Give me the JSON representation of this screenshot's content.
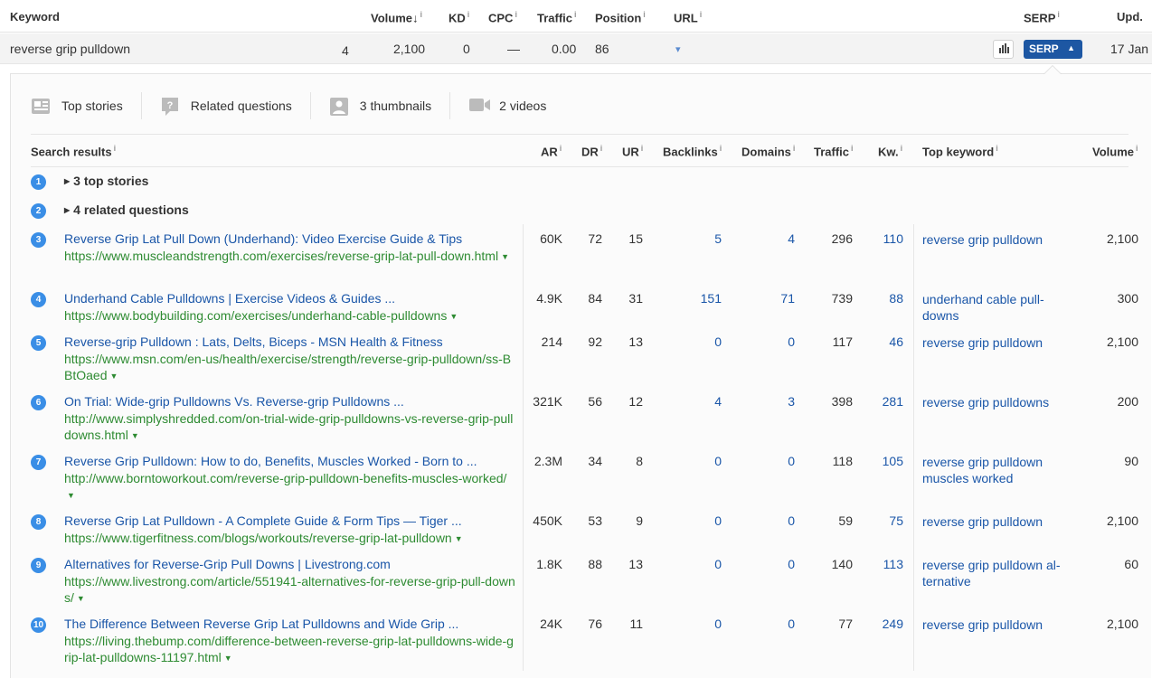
{
  "keyword_table": {
    "headers": {
      "keyword": "Keyword",
      "volume": "Volume",
      "volume_sort": "↓",
      "kd": "KD",
      "cpc": "CPC",
      "traffic": "Traffic",
      "position": "Position",
      "url": "URL",
      "serp": "SERP",
      "upd": "Upd."
    },
    "row": {
      "keyword": "reverse grip pulldown",
      "small_count": "4",
      "volume": "2,100",
      "kd": "0",
      "cpc": "—",
      "traffic": "0.00",
      "position": "86",
      "url_dropdown": "▾",
      "serp_button": "SERP",
      "serp_arrow": "▲",
      "updated": "17 Jan"
    }
  },
  "serp_features": [
    {
      "label": "Top stories",
      "icon": "newspaper-icon"
    },
    {
      "label": "Related questions",
      "icon": "question-bubble-icon"
    },
    {
      "label": "3 thumbnails",
      "icon": "image-icon"
    },
    {
      "label": "2 videos",
      "icon": "video-camera-icon"
    }
  ],
  "results_headers": {
    "search_results": "Search results",
    "ar": "AR",
    "dr": "DR",
    "ur": "UR",
    "backlinks": "Backlinks",
    "domains": "Domains",
    "traffic": "Traffic",
    "kw": "Kw.",
    "top_keyword": "Top keyword",
    "volume": "Volume",
    "info": "i"
  },
  "groups": [
    {
      "num": "1",
      "label": "3 top stories"
    },
    {
      "num": "2",
      "label": "4 related questions"
    }
  ],
  "results": [
    {
      "num": "3",
      "title": "Reverse Grip Lat Pull Down (Underhand): Video Exercise Guide & Tips",
      "url": "https://www.muscleandstrength.com/exercises/reverse-grip-lat-pull-down.html",
      "ar": "60K",
      "dr": "72",
      "ur": "15",
      "backlinks": "5",
      "domains": "4",
      "traffic": "296",
      "kw": "110",
      "top_keyword": "reverse grip pulldown",
      "volume": "2,100"
    },
    {
      "num": "4",
      "title": "Underhand Cable Pulldowns | Exercise Videos & Guides ...",
      "url": "https://www.bodybuilding.com/exercises/underhand-cable-pulldowns",
      "ar": "4.9K",
      "dr": "84",
      "ur": "31",
      "backlinks": "151",
      "domains": "71",
      "traffic": "739",
      "kw": "88",
      "top_keyword": "underhand cable pull-downs",
      "volume": "300"
    },
    {
      "num": "5",
      "title": "Reverse-grip Pulldown : Lats, Delts, Biceps - MSN Health & Fitness",
      "url": "https://www.msn.com/en-us/health/exercise/strength/reverse-grip-pulldown/ss-BBtOaed",
      "ar": "214",
      "dr": "92",
      "ur": "13",
      "backlinks": "0",
      "domains": "0",
      "traffic": "117",
      "kw": "46",
      "top_keyword": "reverse grip pulldown",
      "volume": "2,100"
    },
    {
      "num": "6",
      "title": "On Trial: Wide-grip Pulldowns Vs. Reverse-grip Pulldowns ...",
      "url": "http://www.simplyshredded.com/on-trial-wide-grip-pulldowns-vs-reverse-grip-pulldowns.html",
      "ar": "321K",
      "dr": "56",
      "ur": "12",
      "backlinks": "4",
      "domains": "3",
      "traffic": "398",
      "kw": "281",
      "top_keyword": "reverse grip pulldowns",
      "volume": "200"
    },
    {
      "num": "7",
      "title": "Reverse Grip Pulldown: How to do, Benefits, Muscles Worked - Born to ...",
      "url": "http://www.borntoworkout.com/reverse-grip-pulldown-benefits-muscles-worked/",
      "ar": "2.3M",
      "dr": "34",
      "ur": "8",
      "backlinks": "0",
      "domains": "0",
      "traffic": "118",
      "kw": "105",
      "top_keyword": "reverse grip pulldown muscles worked",
      "volume": "90"
    },
    {
      "num": "8",
      "title": "Reverse Grip Lat Pulldown - A Complete Guide & Form Tips — Tiger ...",
      "url": "https://www.tigerfitness.com/blogs/workouts/reverse-grip-lat-pulldown",
      "ar": "450K",
      "dr": "53",
      "ur": "9",
      "backlinks": "0",
      "domains": "0",
      "traffic": "59",
      "kw": "75",
      "top_keyword": "reverse grip pulldown",
      "volume": "2,100"
    },
    {
      "num": "9",
      "title": "Alternatives for Reverse-Grip Pull Downs | Livestrong.com",
      "url": "https://www.livestrong.com/article/551941-alternatives-for-reverse-grip-pull-downs/",
      "ar": "1.8K",
      "dr": "88",
      "ur": "13",
      "backlinks": "0",
      "domains": "0",
      "traffic": "140",
      "kw": "113",
      "top_keyword": "reverse grip pulldown al-ternative",
      "volume": "60"
    },
    {
      "num": "10",
      "title": "The Difference Between Reverse Grip Lat Pulldowns and Wide Grip ...",
      "url": "https://living.thebump.com/difference-between-reverse-grip-lat-pulldowns-wide-grip-lat-pulldowns-11197.html",
      "ar": "24K",
      "dr": "76",
      "ur": "11",
      "backlinks": "0",
      "domains": "0",
      "traffic": "77",
      "kw": "249",
      "top_keyword": "reverse grip pulldown",
      "volume": "2,100"
    }
  ],
  "colors": {
    "link": "#1a56a8",
    "url_green": "#2e8b32",
    "badge": "#3a8ee6",
    "serp_button": "#1d57a3"
  }
}
